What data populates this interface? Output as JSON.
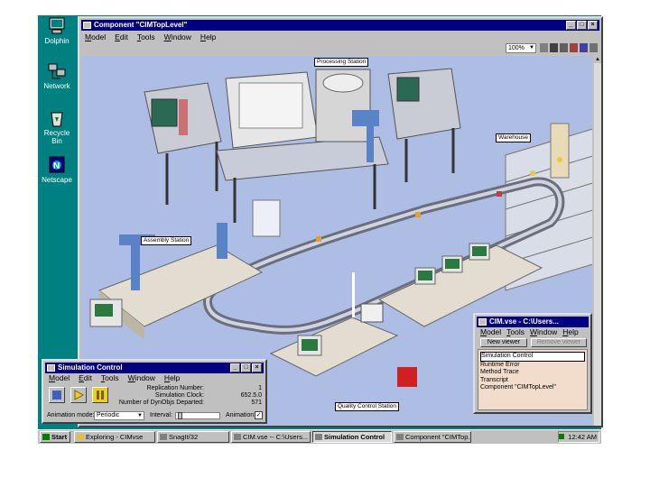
{
  "desktop": {
    "icons": [
      {
        "label": "Dolphin"
      },
      {
        "label": "Network"
      },
      {
        "label": "Recycle Bin"
      },
      {
        "label": "Netscape"
      }
    ]
  },
  "main_window": {
    "title": "Component \"CIMTopLevel\"",
    "menu": [
      "Model",
      "Edit",
      "Tools",
      "Window",
      "Help"
    ],
    "zoom": "100%",
    "stations": {
      "processing": "Processing Station",
      "warehouse": "Warehouse",
      "assembly": "Assembly Station",
      "quality": "Quality Control Station"
    }
  },
  "sim_control": {
    "title": "Simulation Control",
    "menu": [
      "Model",
      "Edit",
      "Tools",
      "Window",
      "Help"
    ],
    "stats": [
      {
        "label": "Replication Number:",
        "value": "1"
      },
      {
        "label": "Simulation Clock:",
        "value": "652.5.0"
      },
      {
        "label": "Number of DynObjs Departed:",
        "value": "571"
      }
    ],
    "animation_mode_label": "Animation mode:",
    "animation_mode_value": "Periodic",
    "interval_label": "Interval:",
    "animation_label": "Animation:"
  },
  "cim_window": {
    "title": "CIM.vse - C:\\Users...",
    "menu": [
      "Model",
      "Tools",
      "Window",
      "Help"
    ],
    "new_viewer": "New viewer",
    "remove_viewer": "Remove viewer",
    "items": [
      "Simulation Control",
      "Runtime Error",
      "Method Trace",
      "Transcript",
      "Component \"CIMTopLevel\""
    ]
  },
  "taskbar": {
    "start": "Start",
    "tasks": [
      "Exploring - CIMvse",
      "SnagIt/32",
      "CIM.vse -- C:\\Users...",
      "Simulation Control",
      "Component \"CIMTop..."
    ],
    "time": "12:42 AM"
  },
  "colors": {
    "desktop": "#008080",
    "titlebar": "#000080",
    "floor": "#a8b8e0",
    "cim_panel": "#f2dccb"
  }
}
